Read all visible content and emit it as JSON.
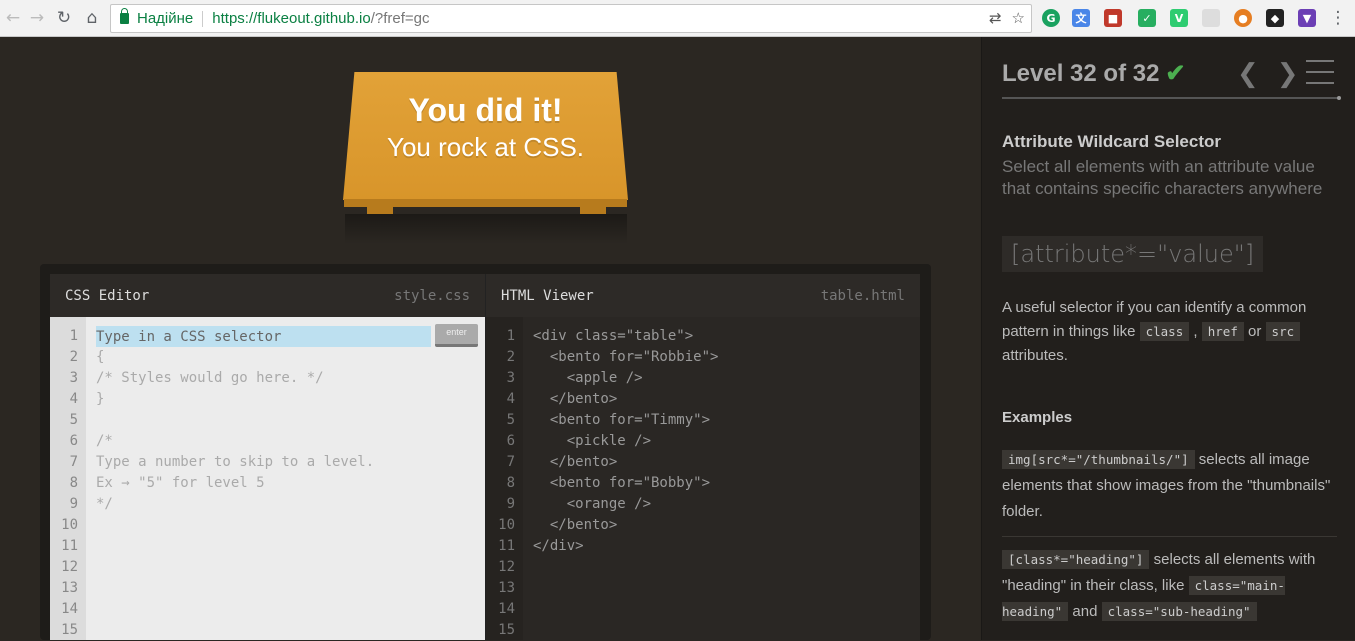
{
  "browser": {
    "secure_label": "Надійне",
    "url_host": "https://flukeout.github.io",
    "url_path": "/?fref=gc",
    "back_icon": "arrow-left",
    "forward_icon": "arrow-right",
    "reload_icon": "reload",
    "home_icon": "home",
    "translate_icon": "translate",
    "star_icon": "star",
    "menu_icon": "vertical-dots"
  },
  "game": {
    "sign_line1": "You did it!",
    "sign_line2": "You rock at CSS."
  },
  "css_editor": {
    "title": "CSS Editor",
    "file": "style.css",
    "input_placeholder": "Type in a CSS selector",
    "enter_label": "enter",
    "line_numbers": [
      "1",
      "2",
      "3",
      "4",
      "5",
      "6",
      "7",
      "8",
      "9",
      "10",
      "11",
      "12",
      "13",
      "14",
      "15"
    ],
    "lines": [
      "{",
      "/* Styles would go here. */",
      "}",
      "",
      "/*",
      "Type a number to skip to a level.",
      "Ex → \"5\" for level 5",
      "*/"
    ]
  },
  "html_viewer": {
    "title": "HTML Viewer",
    "file": "table.html",
    "line_numbers": [
      "1",
      "2",
      "3",
      "4",
      "5",
      "6",
      "7",
      "8",
      "9",
      "10",
      "11",
      "12",
      "13",
      "14",
      "15"
    ],
    "lines": [
      "<div class=\"table\">",
      "  <bento for=\"Robbie\">",
      "    <apple />",
      "  </bento>",
      "  <bento for=\"Timmy\">",
      "    <pickle />",
      "  </bento>",
      "  <bento for=\"Bobby\">",
      "    <orange />",
      "  </bento>",
      "</div>"
    ]
  },
  "sidebar": {
    "level_title": "Level 32 of 32",
    "check": "✔",
    "prev": "❮",
    "next": "❯",
    "selector_name": "Attribute Wildcard Selector",
    "selector_desc": "Select all elements with an attribute value that contains specific characters anywhere",
    "syntax": "[attribute*=\"value\"]",
    "hint_pre": "A useful selector if you can identify a common pattern in things like",
    "hint_code1": "class",
    "hint_code2": "href",
    "hint_or": "or",
    "hint_code3": "src",
    "hint_post": "attributes.",
    "examples_title": "Examples",
    "ex1_code": "img[src*=\"/thumbnails/\"]",
    "ex1_text": "selects all image elements that show images from the \"thumbnails\" folder.",
    "ex2_code": "[class*=\"heading\"]",
    "ex2_text1": "selects all elements with \"heading\" in their class, like",
    "ex2_code2": "class=\"main-heading\"",
    "ex2_and": "and",
    "ex2_code3": "class=\"sub-heading\""
  },
  "colors": {
    "sign": "#dd9a2c",
    "background": "#2b2722",
    "sidebar": "#221f1c",
    "check": "#4caf50"
  }
}
